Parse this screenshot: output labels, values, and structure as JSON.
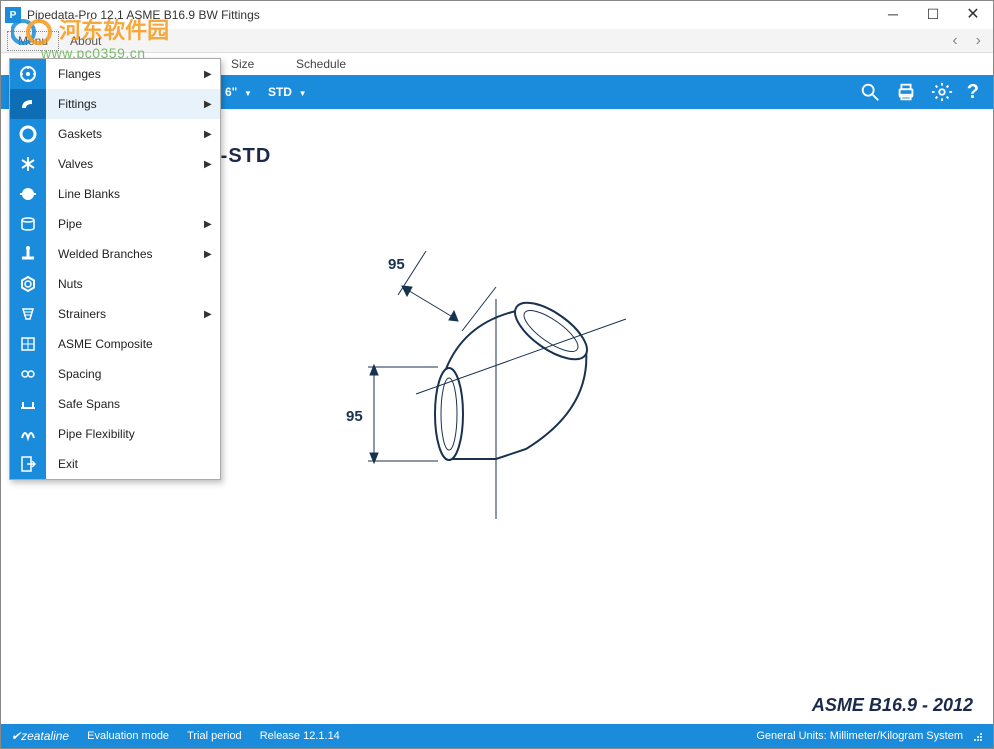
{
  "window": {
    "title": "Pipedata-Pro 12.1 ASME B16.9 BW Fittings",
    "app_initial": "P"
  },
  "watermark": {
    "text": "河东软件园",
    "url": "www.pc0359.cn"
  },
  "menubar": {
    "items": [
      "Menu",
      "About"
    ]
  },
  "toolbar_labels": {
    "size": "Size",
    "schedule": "Schedule"
  },
  "blue_toolbar": {
    "size_value": "6\"",
    "schedule_value": "STD"
  },
  "content": {
    "heading_visible": " Sch-STD",
    "dimension_top": "95",
    "dimension_left": "95",
    "spec": "ASME B16.9 - 2012"
  },
  "dropdown": {
    "items": [
      {
        "label": "Flanges",
        "has_sub": true,
        "icon": "flange"
      },
      {
        "label": "Fittings",
        "has_sub": true,
        "icon": "fitting",
        "highlight": true
      },
      {
        "label": "Gaskets",
        "has_sub": true,
        "icon": "gasket"
      },
      {
        "label": "Valves",
        "has_sub": true,
        "icon": "valve"
      },
      {
        "label": "Line Blanks",
        "has_sub": false,
        "icon": "blank"
      },
      {
        "label": "Pipe",
        "has_sub": true,
        "icon": "pipe"
      },
      {
        "label": "Welded Branches",
        "has_sub": true,
        "icon": "branch"
      },
      {
        "label": "Nuts",
        "has_sub": false,
        "icon": "nut"
      },
      {
        "label": "Strainers",
        "has_sub": true,
        "icon": "strainer"
      },
      {
        "label": "ASME Composite",
        "has_sub": false,
        "icon": "composite"
      },
      {
        "label": "Spacing",
        "has_sub": false,
        "icon": "spacing"
      },
      {
        "label": "Safe Spans",
        "has_sub": false,
        "icon": "span"
      },
      {
        "label": "Pipe Flexibility",
        "has_sub": false,
        "icon": "flex"
      },
      {
        "label": "Exit",
        "has_sub": false,
        "icon": "exit"
      }
    ]
  },
  "statusbar": {
    "brand": "zeataline",
    "mode": "Evaluation mode",
    "trial": "Trial period",
    "release": "Release 12.1.14",
    "units": "General Units: Millimeter/Kilogram System"
  }
}
